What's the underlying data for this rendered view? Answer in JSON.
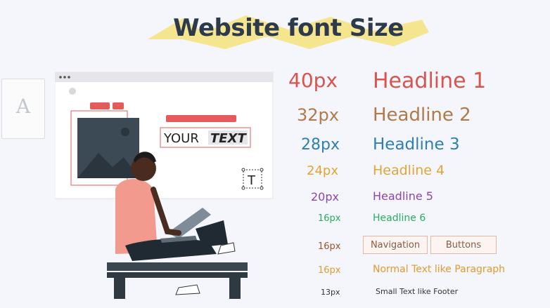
{
  "title": "Website font Size",
  "side_card_glyph": "A",
  "illustration": {
    "your_text_1": "YOUR",
    "your_text_2": "TEXT",
    "text_tool_glyph": "T"
  },
  "rows": [
    {
      "size": "40px",
      "label": "Headline 1",
      "color": "#d9544f"
    },
    {
      "size": "32px",
      "label": "Headline 2",
      "color": "#b07a4a"
    },
    {
      "size": "28px",
      "label": "Headline 3",
      "color": "#2f7fb5"
    },
    {
      "size": "24px",
      "label": "Headline 4",
      "color": "#e2a533"
    },
    {
      "size": "20px",
      "label": "Headline 5",
      "color": "#8e44ad"
    },
    {
      "size": "16px",
      "label": "Headline 6",
      "color": "#27ae60"
    },
    {
      "size": "16px",
      "nav_label": "Navigation",
      "btn_label": "Buttons",
      "color": "#a0522d"
    },
    {
      "size": "16px",
      "label": "Normal Text like Paragraph",
      "color": "#e29a2e"
    },
    {
      "size": "13px",
      "label": "Small Text like Footer",
      "color": "#333333"
    }
  ]
}
